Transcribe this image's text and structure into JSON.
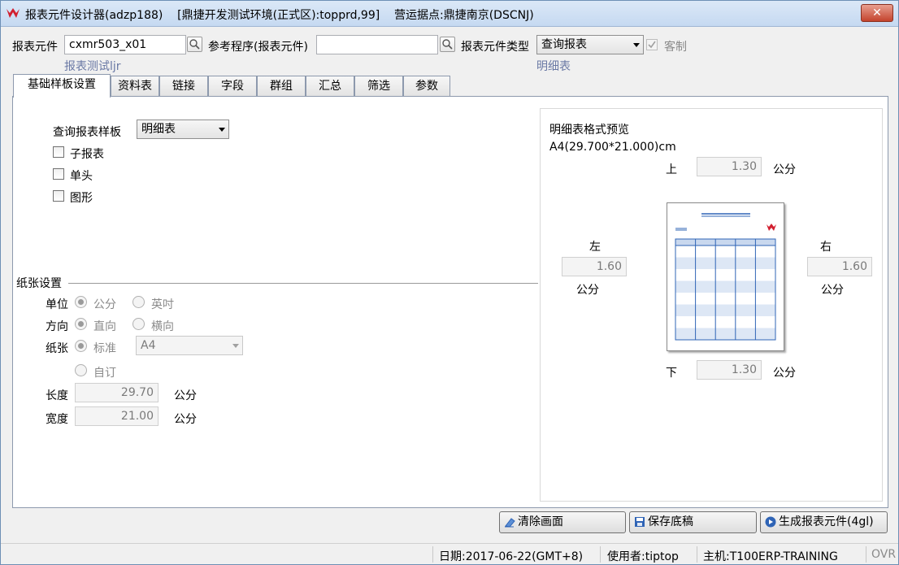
{
  "window": {
    "title": "报表元件设计器(adzp188)    [鼎捷开发测试环境(正式区):topprd,99]    营运据点:鼎捷南京(DSCNJ)",
    "close_label": "✕"
  },
  "header": {
    "report_element_label": "报表元件",
    "report_element_value": "cxmr503_x01",
    "report_element_desc": "报表测试ljr",
    "ref_program_label": "参考程序(报表元件)",
    "ref_program_value": "",
    "type_label": "报表元件类型",
    "type_value": "查询报表",
    "type_desc": "明细表",
    "custom_label": "客制"
  },
  "tabs": [
    {
      "label": "基础样板设置"
    },
    {
      "label": "资料表"
    },
    {
      "label": "链接"
    },
    {
      "label": "字段"
    },
    {
      "label": "群组"
    },
    {
      "label": "汇总"
    },
    {
      "label": "筛选"
    },
    {
      "label": "参数"
    }
  ],
  "basic": {
    "template_label": "查询报表样板",
    "template_value": "明细表",
    "subreport_label": "子报表",
    "single_head_label": "单头",
    "graph_label": "图形"
  },
  "paper": {
    "section_label": "纸张设置",
    "unit_label": "单位",
    "unit_cm": "公分",
    "unit_inch": "英吋",
    "orientation_label": "方向",
    "portrait": "直向",
    "landscape": "横向",
    "paper_label": "纸张",
    "standard": "标准",
    "paper_size": "A4",
    "custom": "自订",
    "length_label": "长度",
    "length_value": "29.70",
    "width_label": "宽度",
    "width_value": "21.00",
    "unit_suffix": "公分"
  },
  "preview": {
    "title": "明细表格式预览",
    "size": "A4(29.700*21.000)cm",
    "top_label": "上",
    "top_value": "1.30",
    "left_label": "左",
    "left_value": "1.60",
    "right_label": "右",
    "right_value": "1.60",
    "bottom_label": "下",
    "bottom_value": "1.30",
    "unit": "公分",
    "table_rows": 8,
    "table_cols": 5
  },
  "buttons": {
    "clear": "清除画面",
    "save": "保存底稿",
    "generate": "生成报表元件(4gl)"
  },
  "status": {
    "date": "日期:2017-06-22(GMT+8)",
    "user": "使用者:tiptop",
    "host": "主机:T100ERP-TRAINING",
    "ovr": "OVR"
  },
  "colors": {
    "accent": "#2f64b6",
    "sublabel": "#6a79a5",
    "logo": "#d21f2f"
  }
}
